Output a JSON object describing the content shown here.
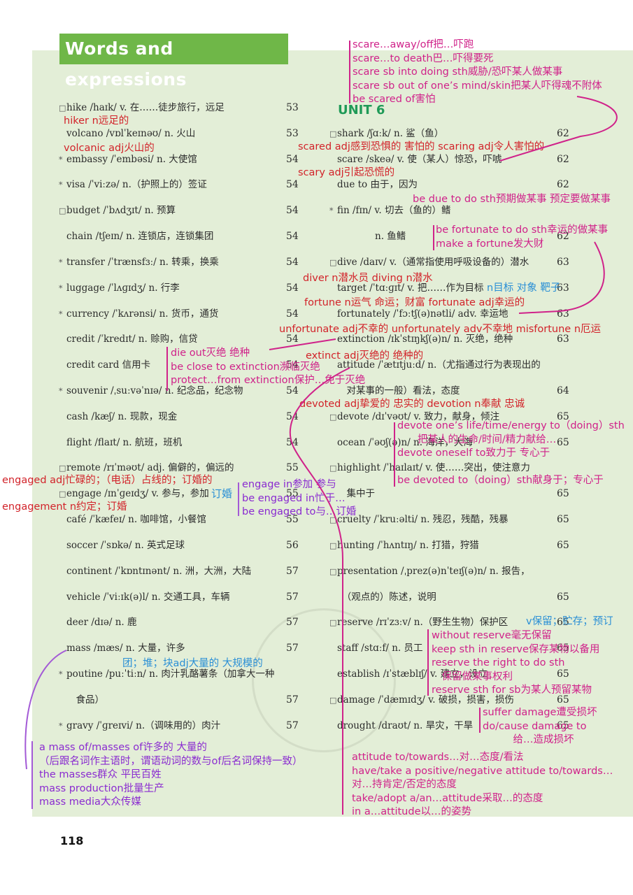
{
  "header": {
    "title": "Words and expressions"
  },
  "unit_heading": "UNIT 6",
  "footer": {
    "page_number": "118"
  },
  "left_column": [
    {
      "mark": "□",
      "text": "hike /haɪk/ v. 在……徒步旅行，远足",
      "page": "53"
    },
    {
      "mark": "",
      "text": "volcano /vɒlˈkeɪnəʊ/ n. 火山",
      "page": "53"
    },
    {
      "mark": "*",
      "text": "embassy /ˈembəsi/ n. 大使馆",
      "page": "54"
    },
    {
      "mark": "*",
      "text": "visa /ˈviːzə/ n.（护照上的）签证",
      "page": "54"
    },
    {
      "mark": "□",
      "text": "budget /ˈbʌdʒɪt/ n. 预算",
      "page": "54"
    },
    {
      "mark": "",
      "text": "chain /tʃeɪn/ n. 连锁店，连锁集团",
      "page": "54"
    },
    {
      "mark": "*",
      "text": "transfer /ˈtrænsfɜː/ n. 转乘，换乘",
      "page": "54"
    },
    {
      "mark": "*",
      "text": "luggage /ˈlʌɡɪdʒ/ n. 行李",
      "page": "54"
    },
    {
      "mark": "*",
      "text": "currency /ˈkʌrənsi/ n. 货币，通货",
      "page": "54"
    },
    {
      "mark": "",
      "text": "credit /ˈkredɪt/ n. 赊购，信贷",
      "page": "54"
    },
    {
      "mark": "",
      "text": "credit card 信用卡",
      "page": "54"
    },
    {
      "mark": "*",
      "text": "souvenir /ˌsuːvəˈnɪə/ n. 纪念品，纪念物",
      "page": "54"
    },
    {
      "mark": "",
      "text": "cash /kæʃ/ n. 现款，现金",
      "page": "54"
    },
    {
      "mark": "",
      "text": "flight /flaɪt/ n. 航班，班机",
      "page": "54"
    },
    {
      "mark": "□",
      "text": "remote /rɪˈməʊt/ adj. 偏僻的，偏远的",
      "page": "55"
    },
    {
      "mark": "□",
      "text": "engage /ɪnˈɡeɪdʒ/ v. 参与，参加",
      "page": "55"
    },
    {
      "mark": "",
      "text": "café /ˈkæfeɪ/ n. 咖啡馆，小餐馆",
      "page": "55"
    },
    {
      "mark": "",
      "text": "soccer /ˈsɒkə/ n. 英式足球",
      "page": "56"
    },
    {
      "mark": "",
      "text": "continent /ˈkɒntɪnənt/ n. 洲，大洲，大陆",
      "page": "57"
    },
    {
      "mark": "",
      "text": "vehicle /ˈviːɪk(ə)l/ n. 交通工具，车辆",
      "page": "57"
    },
    {
      "mark": "",
      "text": "deer /dɪə/ n. 鹿",
      "page": "57"
    },
    {
      "mark": "",
      "text": "mass /mæs/ n. 大量，许多",
      "page": "57"
    },
    {
      "mark": "*",
      "text": "poutine /puːˈtiːn/ n. 肉汁乳酪薯条（加拿大一种",
      "page": ""
    },
    {
      "mark": "",
      "text": "　食品）",
      "page": "57"
    },
    {
      "mark": "*",
      "text": "gravy /ˈɡreɪvi/ n.（调味用的）肉汁",
      "page": "57"
    }
  ],
  "right_column": [
    {
      "mark": "□",
      "text": "shark /ʃɑːk/ n. 鲨（鱼）",
      "page": "62"
    },
    {
      "mark": "",
      "text": "scare /skeə/ v. 使（某人）惊恐，吓唬",
      "page": "62"
    },
    {
      "mark": "",
      "text": "due to 由于，因为",
      "page": "62"
    },
    {
      "mark": "*",
      "text": "fin /fɪn/ v. 切去（鱼的）鳍",
      "page": ""
    },
    {
      "mark": "",
      "text": "　　　　n. 鱼鳍",
      "page": "62"
    },
    {
      "mark": "□",
      "text": "dive /daɪv/ v.（通常指使用呼吸设备的）潜水",
      "page": "63"
    },
    {
      "mark": "",
      "text": "target /ˈtɑːɡɪt/ v. 把……作为目标",
      "page": "63"
    },
    {
      "mark": "",
      "text": "fortunately /ˈfɔːtʃ(ə)nətli/ adv. 幸运地",
      "page": "63"
    },
    {
      "mark": "",
      "text": "extinction /ɪkˈstɪŋkʃ(ə)n/ n. 灭绝，绝种",
      "page": "63"
    },
    {
      "mark": "",
      "text": "attitude /ˈætɪtjuːd/ n.（尤指通过行为表现出的",
      "page": ""
    },
    {
      "mark": "",
      "text": "　对某事的一般）看法，态度",
      "page": "64"
    },
    {
      "mark": "□",
      "text": "devote /dɪˈvəʊt/ v. 致力，献身，倾注",
      "page": "65"
    },
    {
      "mark": "",
      "text": "ocean /ˈəʊʃ(ə)n/ n. 海洋，大海",
      "page": "65"
    },
    {
      "mark": "□",
      "text": "highlight /ˈhaɪlaɪt/ v. 使……突出，使注意力",
      "page": ""
    },
    {
      "mark": "",
      "text": "　集中于",
      "page": "65"
    },
    {
      "mark": "□",
      "text": "cruelty /ˈkruːəlti/ n. 残忍，残酷，残暴",
      "page": "65"
    },
    {
      "mark": "□",
      "text": "hunting /ˈhʌntɪŋ/ n. 打猎，狩猎",
      "page": "65"
    },
    {
      "mark": "□",
      "text": "presentation /ˌprez(ə)nˈteɪʃ(ə)n/ n. 报告，",
      "page": ""
    },
    {
      "mark": "",
      "text": "　（观点的）陈述，说明",
      "page": "65"
    },
    {
      "mark": "□",
      "text": "reserve /rɪˈzɜːv/ n.（野生生物）保护区",
      "page": "65"
    },
    {
      "mark": "",
      "text": "staff /stɑːf/ n. 员工",
      "page": "65"
    },
    {
      "mark": "",
      "text": "establish /ɪˈstæblɪʃ/ v. 建立，设立",
      "page": "65"
    },
    {
      "mark": "□",
      "text": "damage /ˈdæmɪdʒ/ v. 破损，损害，损伤",
      "page": "65"
    },
    {
      "mark": "",
      "text": "drought /draʊt/ n. 旱灾，干旱",
      "page": "65"
    }
  ],
  "annotations": {
    "scare_block": [
      "scare…away/off把…吓跑",
      "scare…to death巴…吓得要死",
      "scare sb into doing sth威胁/恐吓某人做某事",
      "scare sb out of one’s mind/skin把某人吓得魂不附体",
      "be scared of害怕"
    ],
    "hiker": "hiker n远足的",
    "volcanic": "volcanic adj火山的",
    "scared": "scared adj感到恐惧的 害怕的 scaring adj令人害怕的",
    "scary": "scary adj引起恐慌的",
    "due": "be due to do sth预期做某事 预定要做某事",
    "fortunate_block": [
      "be fortunate to do sth幸运的做某事",
      "make a fortune发大财"
    ],
    "diver": "diver n潜水员   diving n潜水",
    "target_note": "n目标 对象 靶子",
    "fortune": "fortune n运气 命运；财富   fortunate adj幸运的",
    "unfortunate": "unfortunate adj不幸的   unfortunately adv不幸地   misfortune n厄运",
    "extinction_block": [
      "die out灭绝 绝种",
      "be close to extinction濒临灭绝",
      "protect…from extinction保护…免于灭绝"
    ],
    "extinct": "extinct adj灭绝的 绝种的",
    "devoted": "devoted adj挚爱的 忠实的   devotion n奉献 忠诚",
    "devote_block": [
      "devote one’s life/time/energy to（doing）sth",
      "　　把某人的生命/时间/精力献给…",
      "devote oneself to致力于 专心于",
      "",
      "be devoted to（doing）sth献身于；专心于"
    ],
    "engaged": "engaged adj忙碌的；（电话）占线的；订婚的",
    "engage_note": "订婚",
    "engagement": "engagement n约定；订婚",
    "engage_block": [
      "engage in参加 参与",
      "be engaged in忙于…",
      "be engaged to与…订婚"
    ],
    "mass_note": "团；堆；块adj大量的 大规模的",
    "mass_block": [
      "a mass of/masses of许多的 大量的",
      "（后跟名词作主语时，谓语动词的数与of后名词保持一致）",
      "the masses群众 平民百姓",
      "mass production批量生产",
      "mass media大众传媒"
    ],
    "reserve_note": "v保留；贮存；预订",
    "reserve_block": [
      "without reserve毫无保留",
      "keep sth in reserve保存某物以备用",
      "reserve the right to do sth",
      "　保留做某事权利",
      "reserve sth for sb为某人预留某物"
    ],
    "damage_block": [
      "suffer damage遭受损坏",
      "do/cause damage to",
      "　　　给…造成损坏"
    ],
    "attitude_block": [
      "attitude to/towards…对…态度/看法",
      "have/take a positive/negative attitude to/towards…",
      "对…持肯定/否定的态度",
      "take/adopt a/an…attitude采取…的态度",
      "in a…attitude以…的姿势"
    ]
  },
  "colors": {
    "panel": "#e3eed7",
    "title_bg": "#6fb748",
    "unit_green": "#1f9a57",
    "note_red": "#d2232a",
    "note_magenta": "#d0228a",
    "note_purple": "#8a2bd0",
    "note_blue": "#2a8fd6"
  }
}
